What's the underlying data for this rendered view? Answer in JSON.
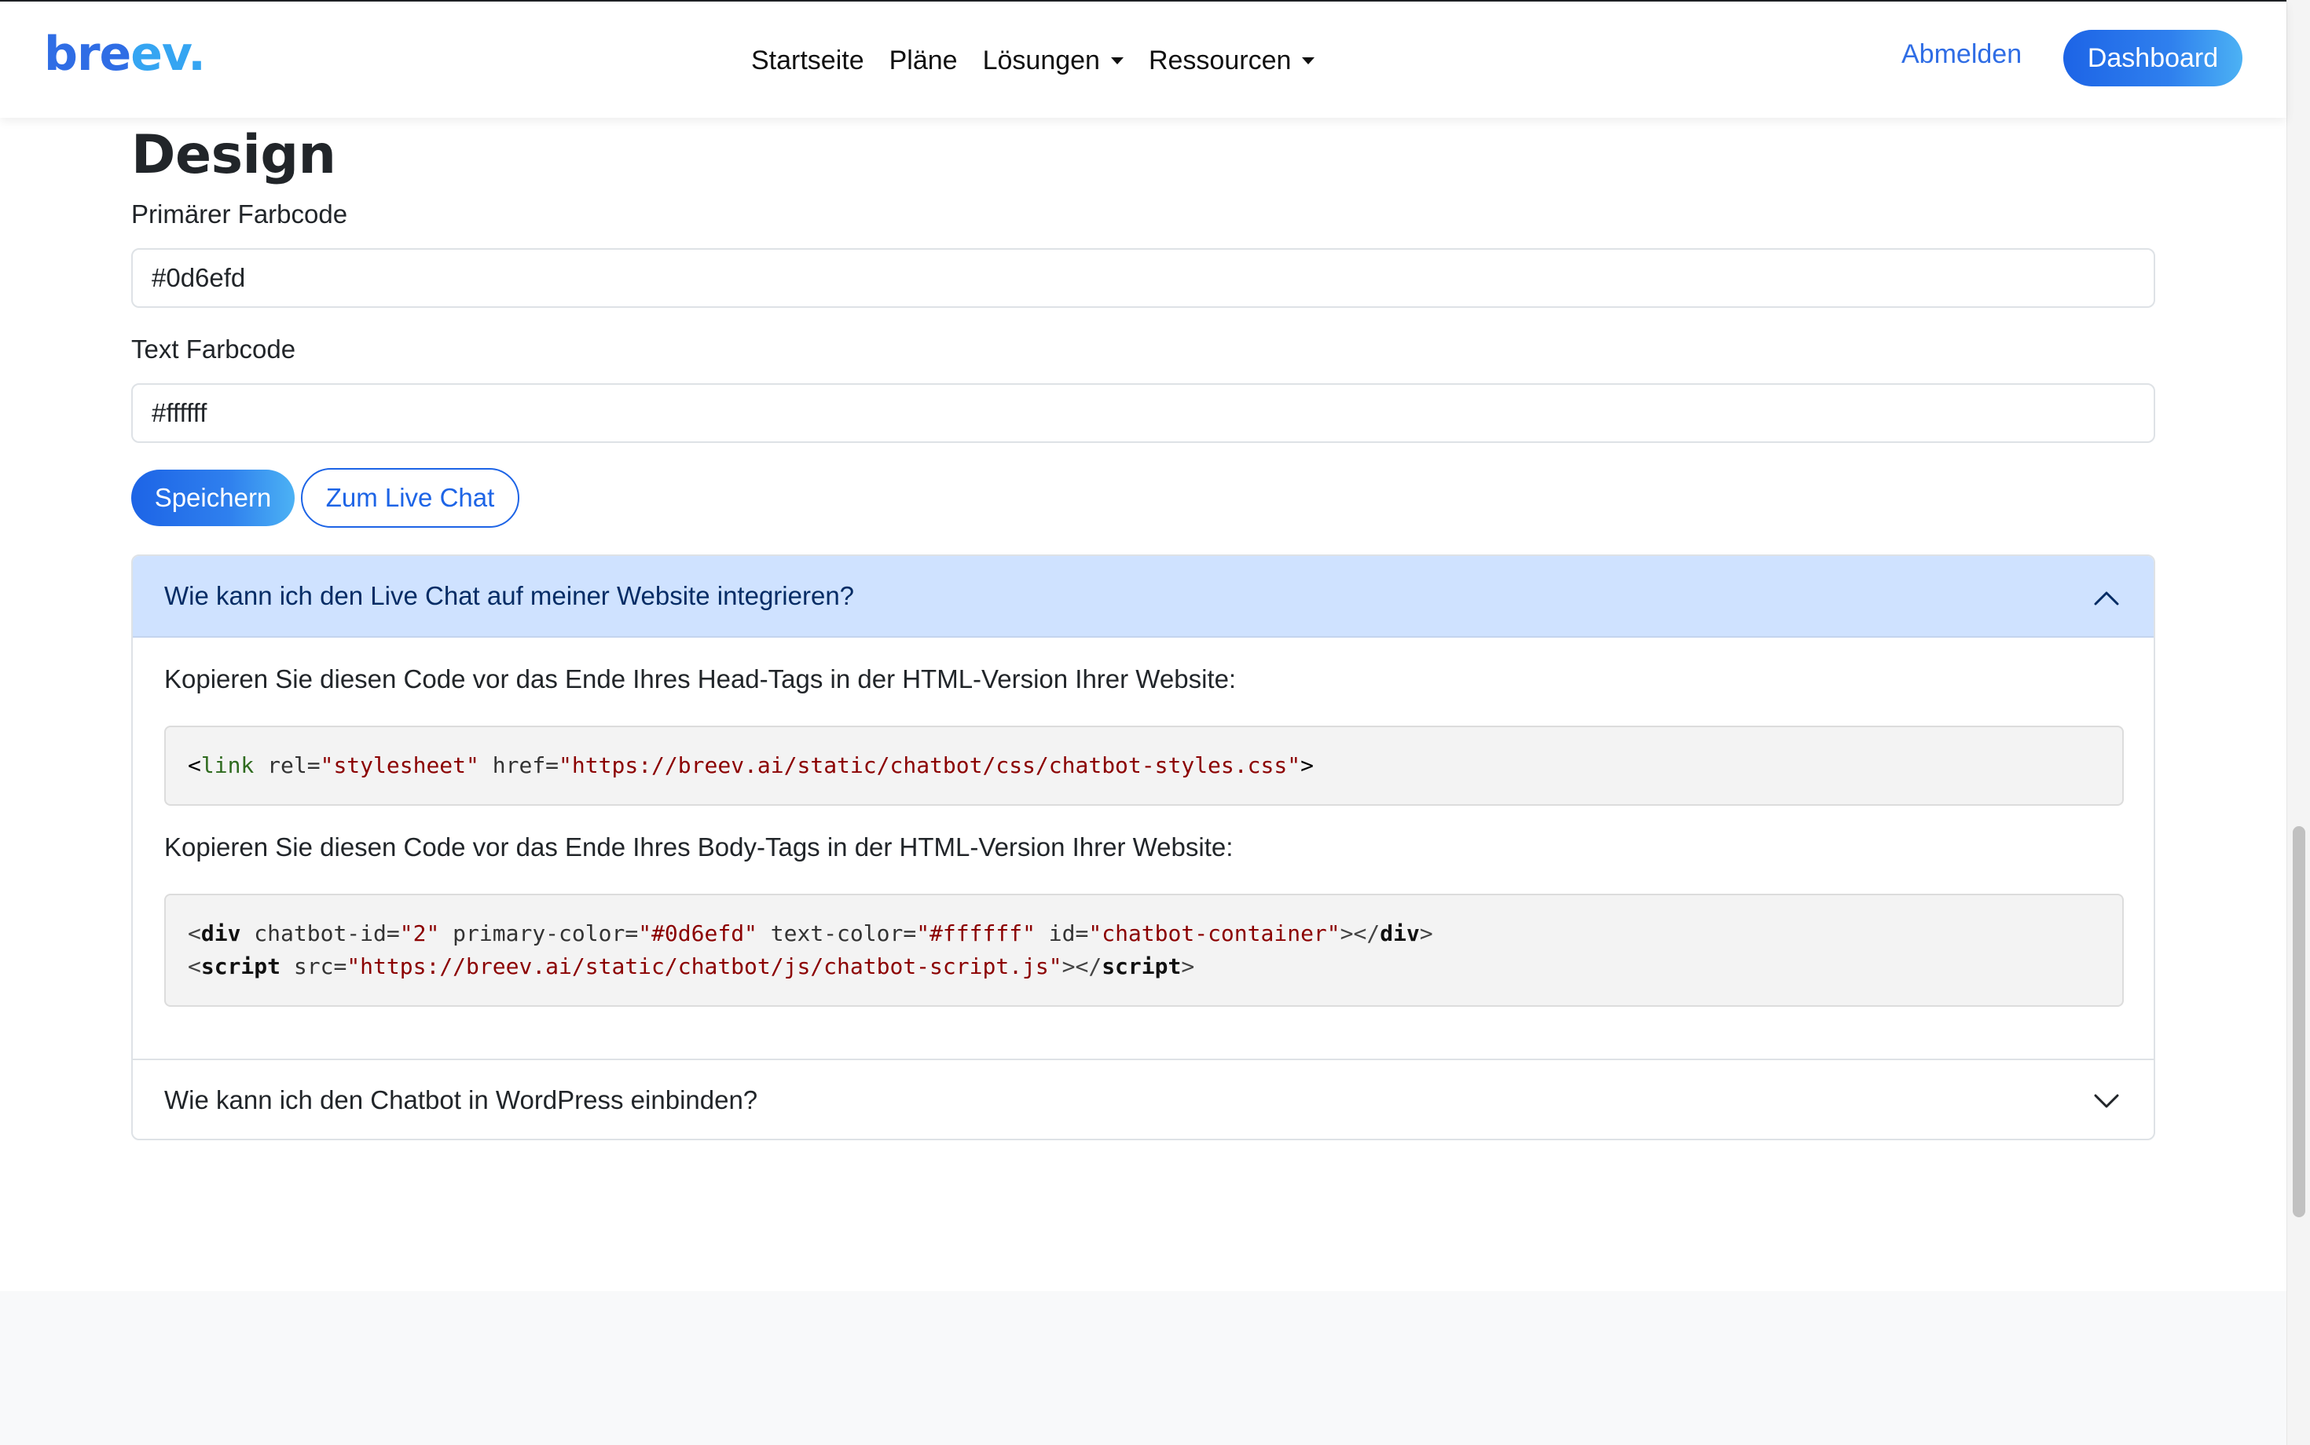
{
  "navbar": {
    "brand_part1": "bre",
    "brand_part2": "ev.",
    "links": [
      "Startseite",
      "Pläne",
      "Lösungen",
      "Ressourcen"
    ],
    "logout_label": "Abmelden",
    "dashboard_label": "Dashboard"
  },
  "design": {
    "title": "Design",
    "primary_label": "Primärer Farbcode",
    "primary_value": "#0d6efd",
    "text_label": "Text Farbcode",
    "text_value": "#ffffff",
    "save_label": "Speichern",
    "live_chat_label": "Zum Live Chat"
  },
  "accordion": {
    "item1_title": "Wie kann ich den Live Chat auf meiner Website integrieren?",
    "head_instruction": "Kopieren Sie diesen Code vor das Ende Ihres Head-Tags in der HTML-Version Ihrer Website:",
    "head_code": {
      "open": "<",
      "tag": "link",
      "attr1": " rel=",
      "val1": "\"stylesheet\"",
      "attr2": " href=",
      "val2": "\"https://breev.ai/static/chatbot/css/chatbot-styles.css\"",
      "close": ">"
    },
    "body_instruction": "Kopieren Sie diesen Code vor das Ende Ihres Body-Tags in der HTML-Version Ihrer Website:",
    "body_code_line1": {
      "open": "<",
      "tag": "div",
      "attr1": " chatbot-id=",
      "val1": "\"2\"",
      "attr2": " primary-color=",
      "val2": "\"#0d6efd\"",
      "attr3": " text-color=",
      "val3": "\"#ffffff\"",
      "attr4": " id=",
      "val4": "\"chatbot-container\"",
      "mid": "></",
      "endtag": "div",
      "close": ">"
    },
    "body_code_line2": {
      "open": "<",
      "tag": "script",
      "attr1": " src=",
      "val1": "\"https://breev.ai/static/chatbot/js/chatbot-script.js\"",
      "mid": "></",
      "endtag": "script",
      "close": ">"
    },
    "item2_title": "Wie kann ich den Chatbot in WordPress einbinden?"
  },
  "colors": {
    "brand_blue": "#2f6de5",
    "accent_light_blue": "#cfe2ff"
  }
}
